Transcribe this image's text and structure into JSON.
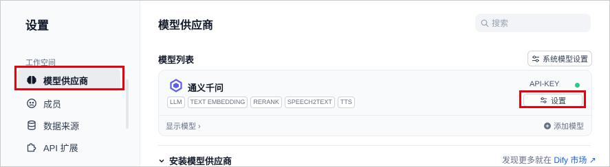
{
  "sidebar": {
    "title": "设置",
    "section": "工作空间",
    "items": [
      {
        "label": "模型供应商",
        "icon": "brain-icon",
        "active": true
      },
      {
        "label": "成员",
        "icon": "members-icon"
      },
      {
        "label": "数据来源",
        "icon": "database-icon"
      },
      {
        "label": "API 扩展",
        "icon": "puzzle-icon"
      }
    ]
  },
  "header": {
    "title": "模型供应商",
    "search_placeholder": "搜索"
  },
  "model_list": {
    "title": "模型列表",
    "system_settings_label": "系统模型设置"
  },
  "provider": {
    "name": "通义千问",
    "tags": [
      "LLM",
      "TEXT EMBEDDING",
      "RERANK",
      "SPEECH2TEXT",
      "TTS"
    ],
    "api_key_label": "API-KEY",
    "status_color": "#31c48d",
    "settings_label": "设置",
    "show_models_label": "显示模型 ›",
    "add_model_label": "添加模型"
  },
  "install": {
    "title": "安装模型供应商",
    "more_prefix": "发现更多就在",
    "more_link": "Dify 市场",
    "more_arrow": "↗"
  },
  "colors": {
    "highlight": "#e8000b",
    "accent": "#155eef"
  }
}
